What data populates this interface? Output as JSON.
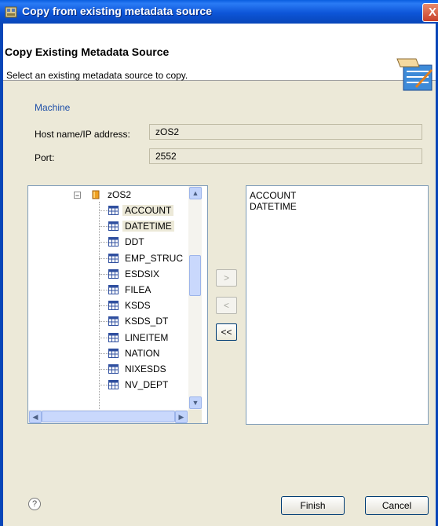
{
  "window": {
    "title": "Copy from existing metadata source",
    "close_glyph": "X"
  },
  "header": {
    "title": "Copy Existing Metadata Source",
    "description": "Select an existing metadata source to copy."
  },
  "form": {
    "section_label": "Machine",
    "host_label": "Host name/IP address:",
    "host_value": "zOS2",
    "port_label": "Port:",
    "port_value": "2552"
  },
  "tree": {
    "root": {
      "label": "zOS2",
      "expander": "−",
      "icon": "cylinder-icon"
    },
    "items": [
      {
        "label": "ACCOUNT",
        "selected": true
      },
      {
        "label": "DATETIME",
        "selected": true
      },
      {
        "label": "DDT",
        "selected": false
      },
      {
        "label": "EMP_STRUC",
        "selected": false
      },
      {
        "label": "ESDSIX",
        "selected": false
      },
      {
        "label": "FILEA",
        "selected": false
      },
      {
        "label": "KSDS",
        "selected": false
      },
      {
        "label": "KSDS_DT",
        "selected": false
      },
      {
        "label": "LINEITEM",
        "selected": false
      },
      {
        "label": "NATION",
        "selected": false
      },
      {
        "label": "NIXESDS",
        "selected": false
      },
      {
        "label": "NV_DEPT",
        "selected": false
      }
    ]
  },
  "move_buttons": {
    "add": ">",
    "remove": "<",
    "remove_all": "<<"
  },
  "selected_list": [
    "ACCOUNT",
    "DATETIME"
  ],
  "footer": {
    "help": "?",
    "finish": "Finish",
    "cancel": "Cancel"
  }
}
